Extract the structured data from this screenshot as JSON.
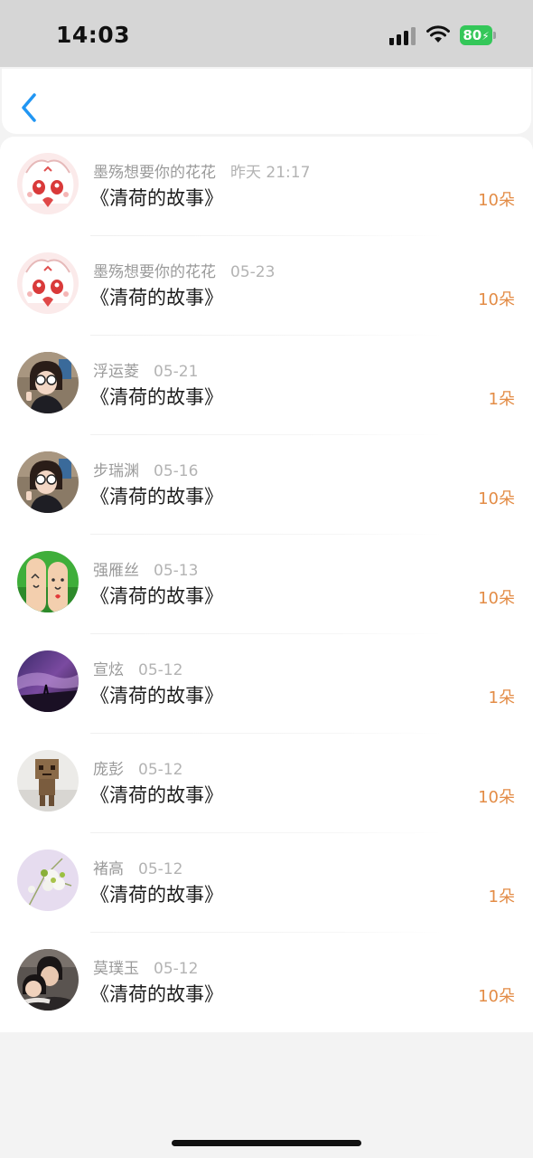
{
  "status_bar": {
    "time": "14:03",
    "battery": "80",
    "icons": [
      "signal-icon",
      "wifi-icon",
      "battery-icon"
    ],
    "battery_color": "#34c759"
  },
  "nav": {
    "back_icon": "chevron-left-icon",
    "accent": "#2196f3"
  },
  "colors": {
    "count": "#e38c46",
    "meta": "#9a9a9a",
    "title": "#1b1b1b"
  },
  "list": [
    {
      "name": "墨殇想要你的花花",
      "date": "昨天 21:17",
      "title": "《清荷的故事》",
      "count": "10朵",
      "avatar": "anime-girl-avatar"
    },
    {
      "name": "墨殇想要你的花花",
      "date": "05-23",
      "title": "《清荷的故事》",
      "count": "10朵",
      "avatar": "anime-girl-avatar"
    },
    {
      "name": "浮运菱",
      "date": "05-21",
      "title": "《清荷的故事》",
      "count": "1朵",
      "avatar": "girl-sunglasses-avatar"
    },
    {
      "name": "步瑞渊",
      "date": "05-16",
      "title": "《清荷的故事》",
      "count": "10朵",
      "avatar": "girl-sunglasses-avatar"
    },
    {
      "name": "强雁丝",
      "date": "05-13",
      "title": "《清荷的故事》",
      "count": "10朵",
      "avatar": "finger-faces-avatar"
    },
    {
      "name": "宣炫",
      "date": "05-12",
      "title": "《清荷的故事》",
      "count": "1朵",
      "avatar": "purple-night-avatar"
    },
    {
      "name": "庞彭",
      "date": "05-12",
      "title": "《清荷的故事》",
      "count": "10朵",
      "avatar": "cardboard-robot-avatar"
    },
    {
      "name": "褚高",
      "date": "05-12",
      "title": "《清荷的故事》",
      "count": "1朵",
      "avatar": "flowers-avatar"
    },
    {
      "name": "莫璞玉",
      "date": "05-12",
      "title": "《清荷的故事》",
      "count": "10朵",
      "avatar": "couple-photo-avatar"
    }
  ]
}
